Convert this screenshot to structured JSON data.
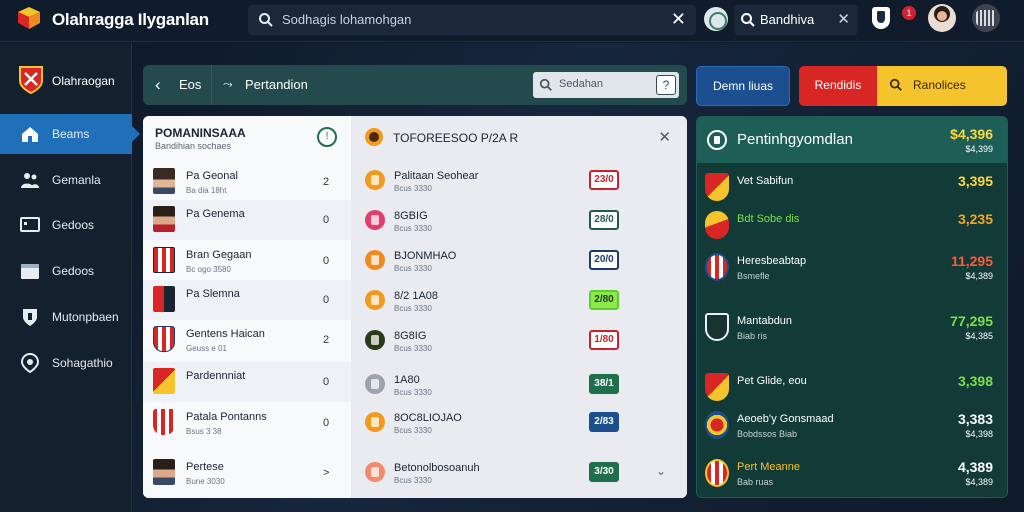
{
  "app": {
    "title": "Olahragga Ilyganlan"
  },
  "top_search": {
    "text": "Sodhagis lohamohgan"
  },
  "top_search2": {
    "text": "Bandhiva"
  },
  "notifications": {
    "count": "1"
  },
  "sidebar": {
    "header": "Olahraogan",
    "items": [
      {
        "label": "Beams",
        "icon": "home-icon"
      },
      {
        "label": "Gemanla",
        "icon": "people-icon"
      },
      {
        "label": "Gedoos",
        "icon": "monitor-icon"
      },
      {
        "label": "Gedoos",
        "icon": "folder-icon"
      },
      {
        "label": "Mutonpbaen",
        "icon": "shield-icon"
      },
      {
        "label": "Sohagathio",
        "icon": "location-icon"
      }
    ]
  },
  "filter_bar": {
    "tab": "Eos",
    "trend_label": "Pertandion",
    "search_placeholder": "Sedahan",
    "search_end": "?"
  },
  "actions": {
    "blue": "Demn liuas",
    "red": "Rendidis",
    "yellow": "Ranolices"
  },
  "left_list": {
    "title": "POMANINSAAA",
    "subtitle": "Bandihian sochaes",
    "rows": [
      {
        "name": "Pa Geonal",
        "meta": "Ba dia 18ht",
        "value": "2"
      },
      {
        "name": "Pa Genema",
        "meta": "",
        "value": "0"
      },
      {
        "name": "Bran Gegaan",
        "meta": "Bc ogo 3580",
        "value": "0"
      },
      {
        "name": "Pa Slemna",
        "meta": "",
        "value": "0"
      },
      {
        "name": "Gentens Haican",
        "meta": "Geuss e 01",
        "value": "2"
      },
      {
        "name": "Pardennniat",
        "meta": "",
        "value": "0"
      },
      {
        "name": "Patala Pontanns",
        "meta": "Bsus 3 38",
        "value": "0"
      },
      {
        "name": "Pertese",
        "meta": "Bune 3030",
        "value": ">"
      }
    ]
  },
  "right_list": {
    "title": "TOFOREESOO P/2A R",
    "rows": [
      {
        "name": "Palitaan Seohear",
        "meta": "Bcus 3330",
        "odds": "23/0"
      },
      {
        "name": "8GBIG",
        "meta": "Bcus 3330",
        "odds": "28/0"
      },
      {
        "name": "BJONMHAO",
        "meta": "Bcus 3330",
        "odds": "20/0"
      },
      {
        "name": "8/2 1A08",
        "meta": "Bcus 3330",
        "odds": "2/80"
      },
      {
        "name": "8G8IG",
        "meta": "Bcus 3330",
        "odds": "1/80"
      },
      {
        "name": "1A80",
        "meta": "Bcus 3330",
        "odds": "38/1"
      },
      {
        "name": "8OC8LIOJAO",
        "meta": "Bcus 3330",
        "odds": "2/83"
      },
      {
        "name": "Betonolbosoanuh",
        "meta": "Bcus 3330",
        "odds": "3/30"
      }
    ]
  },
  "right_panel": {
    "title": "Pentinhgyomdlan",
    "total": "$4,396",
    "total_sub": "$4,399",
    "rows": [
      {
        "name": "Vet Sabifun",
        "meta": "",
        "amount": "3,395",
        "amount_sub": ""
      },
      {
        "name": "Bdt Sobe dis",
        "meta": "",
        "amount": "3,235",
        "amount_sub": ""
      },
      {
        "name": "Heresbeabtap",
        "meta": "Bsmefle",
        "amount": "11,295",
        "amount_sub": "$4,389"
      },
      {
        "name": "Mantabdun",
        "meta": "Biab ris",
        "amount": "77,295",
        "amount_sub": "$4,385"
      },
      {
        "name": "Pet Glide, eou",
        "meta": "",
        "amount": "3,398",
        "amount_sub": ""
      },
      {
        "name": "Aeoeb’y Gonsmaad",
        "meta": "Bobdssos Biab",
        "amount": "3,383",
        "amount_sub": "$4,398"
      },
      {
        "name": "Pert Meanne",
        "meta": "Bab ruas",
        "amount": "4,389",
        "amount_sub": "$4,389"
      }
    ]
  },
  "colors": {
    "accent_blue": "#1f70b8",
    "panel_green": "#1d5e56",
    "red": "#d82624",
    "yellow": "#f5c32b"
  }
}
